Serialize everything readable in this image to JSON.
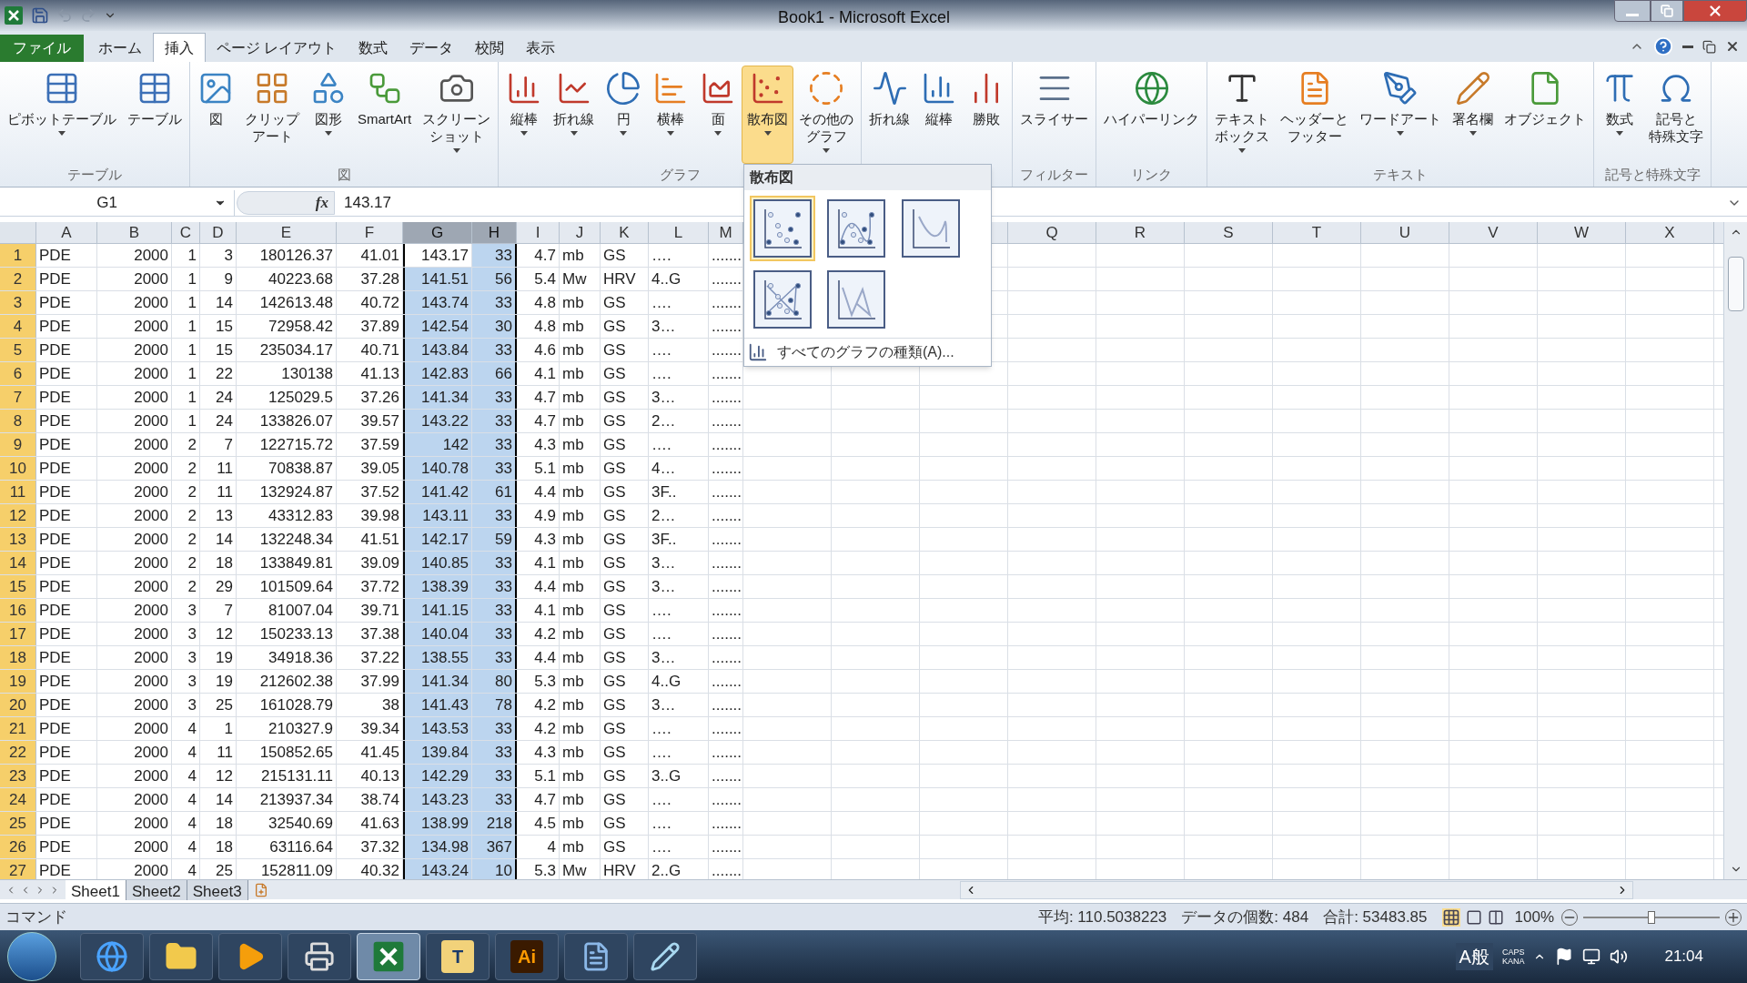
{
  "window": {
    "title": "Book1 - Microsoft Excel"
  },
  "file_tab": {
    "label": "ファイル"
  },
  "ribbon_tabs": [
    {
      "label": "ホーム",
      "kind": "tab",
      "selected": false
    },
    {
      "label": "挿入",
      "kind": "tab",
      "selected": true
    },
    {
      "label": "ページ レイアウト",
      "kind": "tab",
      "selected": false
    },
    {
      "label": "数式",
      "kind": "tab",
      "selected": false
    },
    {
      "label": "データ",
      "kind": "tab",
      "selected": false
    },
    {
      "label": "校閲",
      "kind": "tab",
      "selected": false
    },
    {
      "label": "表示",
      "kind": "tab",
      "selected": false
    }
  ],
  "ribbon_groups": [
    {
      "label": "テーブル",
      "buttons": [
        {
          "lines": [
            "ピボットテーブル"
          ],
          "dropdown": true,
          "selected": false
        },
        {
          "lines": [
            "テーブル"
          ],
          "dropdown": false,
          "selected": false
        }
      ]
    },
    {
      "label": "図",
      "buttons": [
        {
          "lines": [
            "図"
          ],
          "dropdown": false,
          "selected": false
        },
        {
          "lines": [
            "クリップ",
            "アート"
          ],
          "dropdown": false,
          "selected": false
        },
        {
          "lines": [
            "図形"
          ],
          "dropdown": true,
          "selected": false
        },
        {
          "lines": [
            "SmartArt"
          ],
          "dropdown": false,
          "selected": false
        },
        {
          "lines": [
            "スクリーン",
            "ショット"
          ],
          "dropdown": true,
          "selected": false
        }
      ]
    },
    {
      "label": "グラフ",
      "buttons": [
        {
          "lines": [
            "縦棒"
          ],
          "dropdown": true,
          "selected": false
        },
        {
          "lines": [
            "折れ線"
          ],
          "dropdown": true,
          "selected": false
        },
        {
          "lines": [
            "円"
          ],
          "dropdown": true,
          "selected": false
        },
        {
          "lines": [
            "横棒"
          ],
          "dropdown": true,
          "selected": false
        },
        {
          "lines": [
            "面"
          ],
          "dropdown": true,
          "selected": false
        },
        {
          "lines": [
            "散布図"
          ],
          "dropdown": true,
          "selected": true
        },
        {
          "lines": [
            "その他の",
            "グラフ"
          ],
          "dropdown": true,
          "selected": false
        }
      ]
    },
    {
      "buttons": [
        {
          "lines": [
            "折れ線"
          ],
          "dropdown": false,
          "selected": false
        },
        {
          "lines": [
            "縦棒"
          ],
          "dropdown": false,
          "selected": false
        },
        {
          "lines": [
            "勝敗"
          ],
          "dropdown": false,
          "selected": false
        }
      ]
    },
    {
      "label": "フィルター",
      "buttons": [
        {
          "lines": [
            "スライサー"
          ],
          "dropdown": false,
          "selected": false
        }
      ]
    },
    {
      "label": "リンク",
      "buttons": [
        {
          "lines": [
            "ハイパーリンク"
          ],
          "dropdown": false,
          "selected": false
        }
      ]
    },
    {
      "label": "テキスト",
      "buttons": [
        {
          "lines": [
            "テキスト",
            "ボックス"
          ],
          "dropdown": true,
          "selected": false
        },
        {
          "lines": [
            "ヘッダーと",
            "フッター"
          ],
          "dropdown": false,
          "selected": false
        },
        {
          "lines": [
            "ワードアート"
          ],
          "dropdown": true,
          "selected": false
        },
        {
          "lines": [
            "署名欄"
          ],
          "dropdown": true,
          "selected": false
        },
        {
          "lines": [
            "オブジェクト"
          ],
          "dropdown": false,
          "selected": false
        }
      ]
    },
    {
      "label": "記号と特殊文字",
      "buttons": [
        {
          "lines": [
            "数式"
          ],
          "dropdown": true,
          "selected": false
        },
        {
          "lines": [
            "記号と",
            "特殊文字"
          ],
          "dropdown": false,
          "selected": false
        }
      ]
    }
  ],
  "scatter_menu": {
    "title": "散布図",
    "options": [
      {
        "selected": true
      },
      {
        "selected": false
      },
      {
        "selected": false
      },
      {
        "selected": false
      },
      {
        "selected": false
      }
    ],
    "footer": "すべてのグラフの種類(A)..."
  },
  "formula_bar": {
    "name_box": "G1",
    "function_button": "fx",
    "value": "143.17"
  },
  "columns": [
    {
      "label": "A",
      "selected": false
    },
    {
      "label": "B",
      "selected": false
    },
    {
      "label": "C",
      "selected": false
    },
    {
      "label": "D",
      "selected": false
    },
    {
      "label": "E",
      "selected": false
    },
    {
      "label": "F",
      "selected": false
    },
    {
      "label": "G",
      "selected": true
    },
    {
      "label": "H",
      "selected": true
    },
    {
      "label": "I",
      "selected": false
    },
    {
      "label": "J",
      "selected": false
    },
    {
      "label": "K",
      "selected": false
    },
    {
      "label": "L",
      "selected": false
    },
    {
      "label": "M",
      "selected": false
    }
  ],
  "columns_right": [
    {
      "label": "Q",
      "selected": false
    },
    {
      "label": "R",
      "selected": false
    },
    {
      "label": "S",
      "selected": false
    },
    {
      "label": "T",
      "selected": false
    },
    {
      "label": "U",
      "selected": false
    },
    {
      "label": "V",
      "selected": false
    },
    {
      "label": "W",
      "selected": false
    },
    {
      "label": "X",
      "selected": false
    }
  ],
  "rows": [
    {
      "label": "1",
      "selected": true,
      "cells": [
        "PDE",
        "2000",
        "1",
        "3",
        "180126.37",
        "41.01",
        "143.17",
        "33",
        "4.7",
        "mb",
        "GS",
        "….",
        "......."
      ]
    },
    {
      "label": "2",
      "selected": true,
      "cells": [
        "PDE",
        "2000",
        "1",
        "9",
        "40223.68",
        "37.28",
        "141.51",
        "56",
        "5.4",
        "Mw",
        "HRV",
        "4..G",
        "......."
      ]
    },
    {
      "label": "3",
      "selected": true,
      "cells": [
        "PDE",
        "2000",
        "1",
        "14",
        "142613.48",
        "40.72",
        "143.74",
        "33",
        "4.8",
        "mb",
        "GS",
        "….",
        "......."
      ]
    },
    {
      "label": "4",
      "selected": true,
      "cells": [
        "PDE",
        "2000",
        "1",
        "15",
        "72958.42",
        "37.89",
        "142.54",
        "30",
        "4.8",
        "mb",
        "GS",
        "3…",
        "......."
      ]
    },
    {
      "label": "5",
      "selected": true,
      "cells": [
        "PDE",
        "2000",
        "1",
        "15",
        "235034.17",
        "40.71",
        "143.84",
        "33",
        "4.6",
        "mb",
        "GS",
        "….",
        "......."
      ]
    },
    {
      "label": "6",
      "selected": true,
      "cells": [
        "PDE",
        "2000",
        "1",
        "22",
        "130138",
        "41.13",
        "142.83",
        "66",
        "4.1",
        "mb",
        "GS",
        "….",
        "......."
      ]
    },
    {
      "label": "7",
      "selected": true,
      "cells": [
        "PDE",
        "2000",
        "1",
        "24",
        "125029.5",
        "37.26",
        "141.34",
        "33",
        "4.7",
        "mb",
        "GS",
        "3…",
        "......."
      ]
    },
    {
      "label": "8",
      "selected": true,
      "cells": [
        "PDE",
        "2000",
        "1",
        "24",
        "133826.07",
        "39.57",
        "143.22",
        "33",
        "4.7",
        "mb",
        "GS",
        "2…",
        "......."
      ]
    },
    {
      "label": "9",
      "selected": true,
      "cells": [
        "PDE",
        "2000",
        "2",
        "7",
        "122715.72",
        "37.59",
        "142",
        "33",
        "4.3",
        "mb",
        "GS",
        "….",
        "......."
      ]
    },
    {
      "label": "10",
      "selected": true,
      "cells": [
        "PDE",
        "2000",
        "2",
        "11",
        "70838.87",
        "39.05",
        "140.78",
        "33",
        "5.1",
        "mb",
        "GS",
        "4…",
        "......."
      ]
    },
    {
      "label": "11",
      "selected": true,
      "cells": [
        "PDE",
        "2000",
        "2",
        "11",
        "132924.87",
        "37.52",
        "141.42",
        "61",
        "4.4",
        "mb",
        "GS",
        "3F..",
        "......."
      ]
    },
    {
      "label": "12",
      "selected": true,
      "cells": [
        "PDE",
        "2000",
        "2",
        "13",
        "43312.83",
        "39.98",
        "143.11",
        "33",
        "4.9",
        "mb",
        "GS",
        "2…",
        "......."
      ]
    },
    {
      "label": "13",
      "selected": true,
      "cells": [
        "PDE",
        "2000",
        "2",
        "14",
        "132248.34",
        "41.51",
        "142.17",
        "59",
        "4.3",
        "mb",
        "GS",
        "3F..",
        "......."
      ]
    },
    {
      "label": "14",
      "selected": true,
      "cells": [
        "PDE",
        "2000",
        "2",
        "18",
        "133849.81",
        "39.09",
        "140.85",
        "33",
        "4.1",
        "mb",
        "GS",
        "3…",
        "......."
      ]
    },
    {
      "label": "15",
      "selected": true,
      "cells": [
        "PDE",
        "2000",
        "2",
        "29",
        "101509.64",
        "37.72",
        "138.39",
        "33",
        "4.4",
        "mb",
        "GS",
        "3…",
        "......."
      ]
    },
    {
      "label": "16",
      "selected": true,
      "cells": [
        "PDE",
        "2000",
        "3",
        "7",
        "81007.04",
        "39.71",
        "141.15",
        "33",
        "4.1",
        "mb",
        "GS",
        "….",
        "......."
      ]
    },
    {
      "label": "17",
      "selected": true,
      "cells": [
        "PDE",
        "2000",
        "3",
        "12",
        "150233.13",
        "37.38",
        "140.04",
        "33",
        "4.2",
        "mb",
        "GS",
        "….",
        "......."
      ]
    },
    {
      "label": "18",
      "selected": true,
      "cells": [
        "PDE",
        "2000",
        "3",
        "19",
        "34918.36",
        "37.22",
        "138.55",
        "33",
        "4.4",
        "mb",
        "GS",
        "3…",
        "......."
      ]
    },
    {
      "label": "19",
      "selected": true,
      "cells": [
        "PDE",
        "2000",
        "3",
        "19",
        "212602.38",
        "37.99",
        "141.34",
        "80",
        "5.3",
        "mb",
        "GS",
        "4..G",
        "......."
      ]
    },
    {
      "label": "20",
      "selected": true,
      "cells": [
        "PDE",
        "2000",
        "3",
        "25",
        "161028.79",
        "38",
        "141.43",
        "78",
        "4.2",
        "mb",
        "GS",
        "3…",
        "......."
      ]
    },
    {
      "label": "21",
      "selected": true,
      "cells": [
        "PDE",
        "2000",
        "4",
        "1",
        "210327.9",
        "39.34",
        "143.53",
        "33",
        "4.2",
        "mb",
        "GS",
        "….",
        "......."
      ]
    },
    {
      "label": "22",
      "selected": true,
      "cells": [
        "PDE",
        "2000",
        "4",
        "11",
        "150852.65",
        "41.45",
        "139.84",
        "33",
        "4.3",
        "mb",
        "GS",
        "….",
        "......."
      ]
    },
    {
      "label": "23",
      "selected": true,
      "cells": [
        "PDE",
        "2000",
        "4",
        "12",
        "215131.11",
        "40.13",
        "142.29",
        "33",
        "5.1",
        "mb",
        "GS",
        "3..G",
        "......."
      ]
    },
    {
      "label": "24",
      "selected": true,
      "cells": [
        "PDE",
        "2000",
        "4",
        "14",
        "213937.34",
        "38.74",
        "143.23",
        "33",
        "4.7",
        "mb",
        "GS",
        "….",
        "......."
      ]
    },
    {
      "label": "25",
      "selected": true,
      "cells": [
        "PDE",
        "2000",
        "4",
        "18",
        "32540.69",
        "41.63",
        "138.99",
        "218",
        "4.5",
        "mb",
        "GS",
        "….",
        "......."
      ]
    },
    {
      "label": "26",
      "selected": true,
      "cells": [
        "PDE",
        "2000",
        "4",
        "18",
        "63116.64",
        "37.32",
        "134.98",
        "367",
        "4",
        "mb",
        "GS",
        "….",
        "......."
      ]
    },
    {
      "label": "27",
      "selected": true,
      "cells": [
        "PDE",
        "2000",
        "4",
        "25",
        "152811.09",
        "40.32",
        "143.24",
        "10",
        "5.3",
        "Mw",
        "HRV",
        "2..G",
        "......."
      ]
    }
  ],
  "sheet_tabs": [
    {
      "label": "Sheet1",
      "selected": true
    },
    {
      "label": "Sheet2",
      "selected": false
    },
    {
      "label": "Sheet3",
      "selected": false
    }
  ],
  "status_bar": {
    "mode": "コマンド",
    "average": "平均: 110.5038223",
    "count": "データの個数: 484",
    "sum": "合計: 53483.85",
    "zoom": "100%",
    "zoom_level": {
      "level": 0.5
    }
  },
  "taskbar": {
    "apps": [
      {
        "selected": false
      },
      {
        "selected": false
      },
      {
        "selected": false
      },
      {
        "selected": false
      },
      {
        "selected": true
      },
      {
        "glyph": "T",
        "selected": false
      },
      {
        "glyph": "Ai",
        "selected": false
      },
      {
        "selected": false
      },
      {
        "selected": false
      }
    ],
    "ime": "A般",
    "caps": "CAPS",
    "kana": "KANA",
    "clock": "21:04"
  }
}
